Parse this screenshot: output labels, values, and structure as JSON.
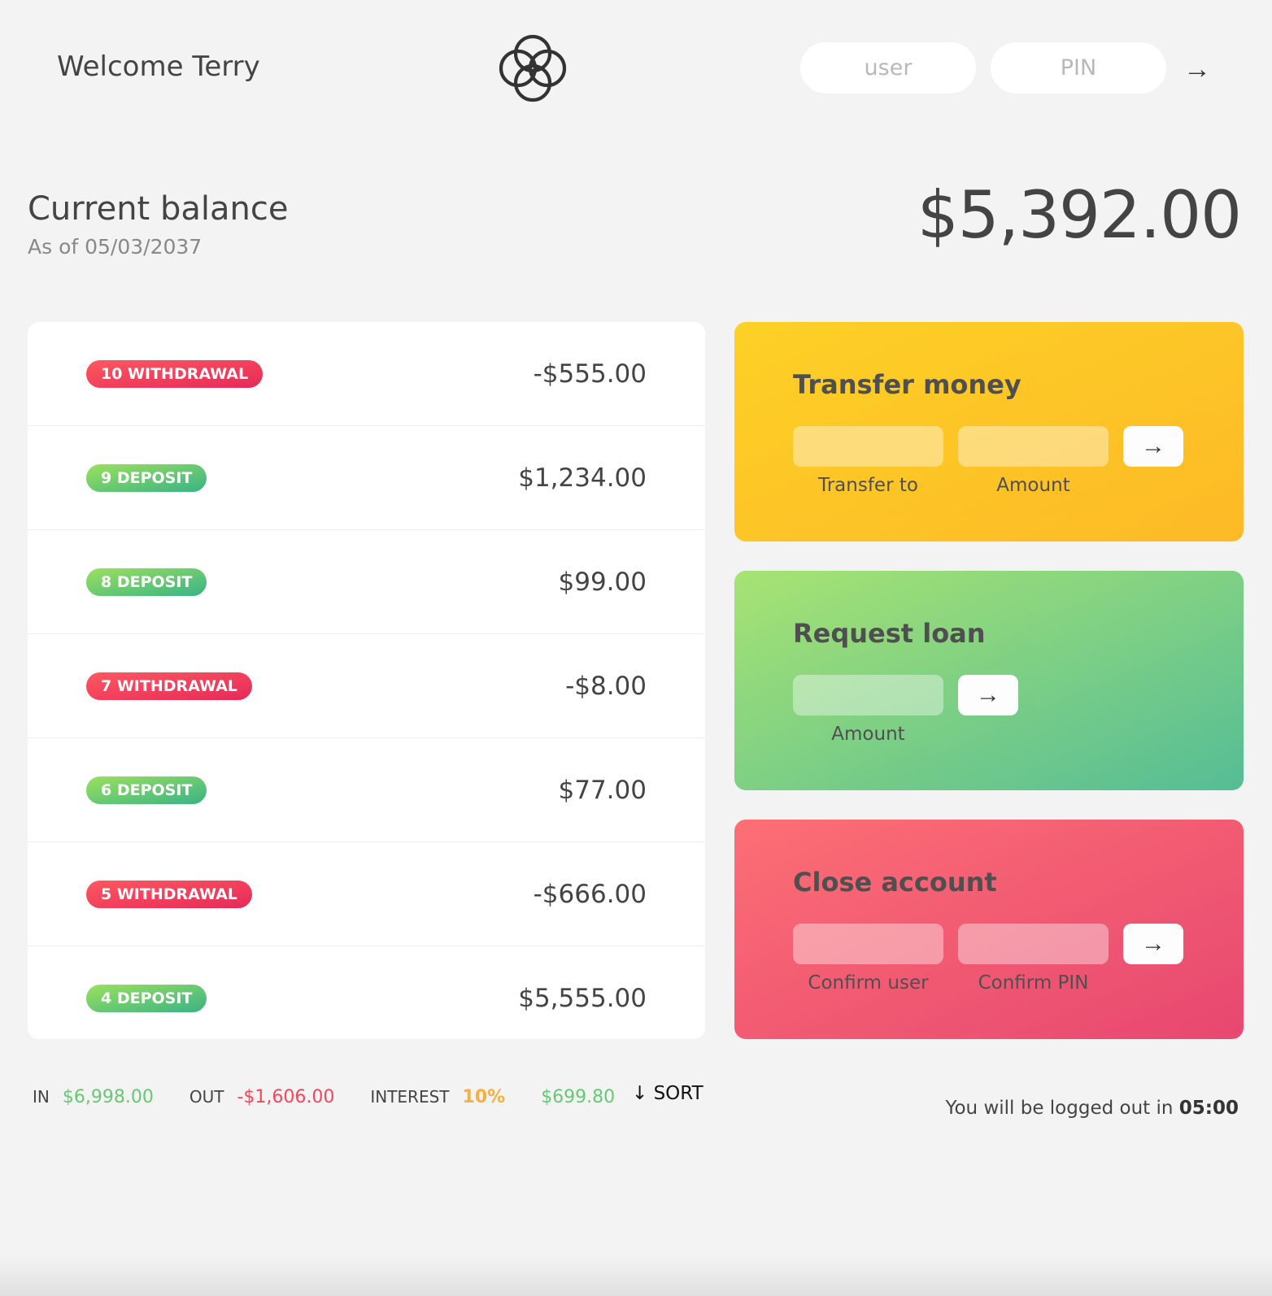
{
  "nav": {
    "welcome": "Welcome Terry",
    "user_placeholder": "user",
    "pin_placeholder": "PIN",
    "login_arrow": "→"
  },
  "balance": {
    "label": "Current balance",
    "date_prefix": "As of",
    "date": "05/03/2037",
    "value": "$5,392.00"
  },
  "movements": [
    {
      "type_label": "10 WITHDRAWAL",
      "kind": "withdrawal",
      "value": "-$555.00"
    },
    {
      "type_label": "9 DEPOSIT",
      "kind": "deposit",
      "value": "$1,234.00"
    },
    {
      "type_label": "8 DEPOSIT",
      "kind": "deposit",
      "value": "$99.00"
    },
    {
      "type_label": "7 WITHDRAWAL",
      "kind": "withdrawal",
      "value": "-$8.00"
    },
    {
      "type_label": "6 DEPOSIT",
      "kind": "deposit",
      "value": "$77.00"
    },
    {
      "type_label": "5 WITHDRAWAL",
      "kind": "withdrawal",
      "value": "-$666.00"
    },
    {
      "type_label": "4 DEPOSIT",
      "kind": "deposit",
      "value": "$5,555.00"
    }
  ],
  "operations": {
    "transfer": {
      "title": "Transfer money",
      "label1": "Transfer to",
      "label2": "Amount",
      "arrow": "→"
    },
    "loan": {
      "title": "Request loan",
      "label1": "Amount",
      "arrow": "→"
    },
    "close": {
      "title": "Close account",
      "label1": "Confirm user",
      "label2": "Confirm PIN",
      "arrow": "→"
    }
  },
  "summary": {
    "in_label": "In",
    "in_value": "$6,998.00",
    "out_label": "Out",
    "out_value": "-$1,606.00",
    "interest_label": "Interest",
    "interest_rate": "10%",
    "interest_value": "$699.80",
    "sort_label": "↓ SORT"
  },
  "logout": {
    "text": "You will be logged out in",
    "timer": "05:00"
  },
  "colors": {
    "background": "#f3f3f3",
    "deposit": "#66c873",
    "withdrawal": "#f5465d",
    "rate": "#f5b041",
    "transfer_card": "#ffb003",
    "loan_card": "#39b385",
    "close_card": "#e52a5a"
  }
}
